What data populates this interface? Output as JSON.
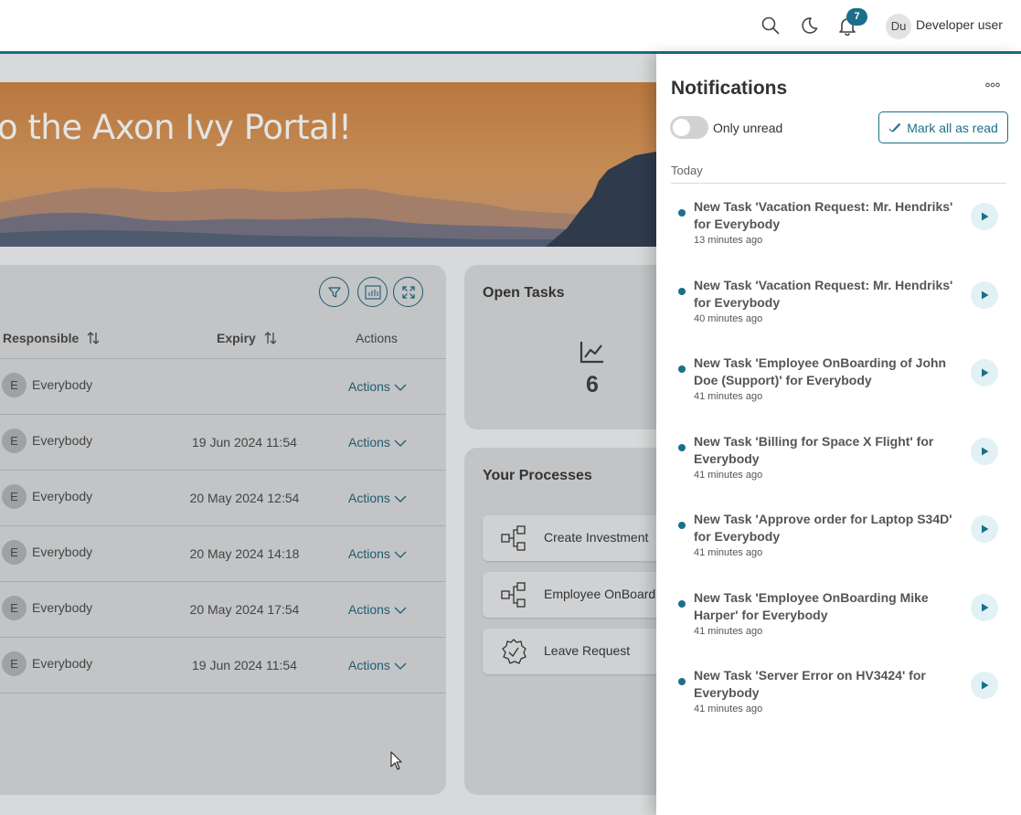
{
  "topbar": {
    "search_icon": "search-icon",
    "theme_icon": "moon-icon",
    "bell_icon": "bell-icon",
    "notification_count": "7",
    "user_initials": "Du",
    "user_name": "Developer user"
  },
  "banner": {
    "welcome_text": "o the Axon Ivy Portal!"
  },
  "tasks": {
    "columns": {
      "responsible": "Responsible",
      "expiry": "Expiry",
      "actions": "Actions"
    },
    "rows": [
      {
        "initial": "E",
        "responsible": "Everybody",
        "expiry": "",
        "action": "Actions"
      },
      {
        "initial": "E",
        "responsible": "Everybody",
        "expiry": "19 Jun 2024 11:54",
        "action": "Actions"
      },
      {
        "initial": "E",
        "responsible": "Everybody",
        "expiry": "20 May 2024 12:54",
        "action": "Actions"
      },
      {
        "initial": "E",
        "responsible": "Everybody",
        "expiry": "20 May 2024 14:18",
        "action": "Actions"
      },
      {
        "initial": "E",
        "responsible": "Everybody",
        "expiry": "20 May 2024 17:54",
        "action": "Actions"
      },
      {
        "initial": "E",
        "responsible": "Everybody",
        "expiry": "19 Jun 2024 11:54",
        "action": "Actions"
      }
    ]
  },
  "open_tasks": {
    "title": "Open Tasks",
    "count": "6"
  },
  "processes": {
    "title": "Your Processes",
    "items": [
      {
        "label": "Create Investment",
        "icon": "workflow-icon"
      },
      {
        "label": "Employee OnBoarding",
        "icon": "workflow-icon"
      },
      {
        "label": "Leave Request",
        "icon": "badge-icon"
      }
    ]
  },
  "notifications": {
    "title": "Notifications",
    "only_unread_label": "Only unread",
    "mark_all_label": "Mark all as read",
    "group_label": "Today",
    "items": [
      {
        "text": "New Task 'Vacation Request: Mr. Hendriks' for Everybody",
        "time": "13 minutes ago"
      },
      {
        "text": "New Task 'Vacation Request: Mr. Hendriks' for Everybody",
        "time": "40 minutes ago"
      },
      {
        "text": "New Task 'Employee OnBoarding of John Doe (Support)' for Everybody",
        "time": "41 minutes ago"
      },
      {
        "text": "New Task 'Billing for Space X Flight' for Everybody",
        "time": "41 minutes ago"
      },
      {
        "text": "New Task 'Approve order for Laptop S34D' for Everybody",
        "time": "41 minutes ago"
      },
      {
        "text": "New Task 'Employee OnBoarding Mike Harper' for Everybody",
        "time": "41 minutes ago"
      },
      {
        "text": "New Task 'Server Error on HV3424' for Everybody",
        "time": "41 minutes ago"
      }
    ]
  },
  "colors": {
    "accent": "#1b6f8a",
    "overlay": "#d7d9da"
  }
}
